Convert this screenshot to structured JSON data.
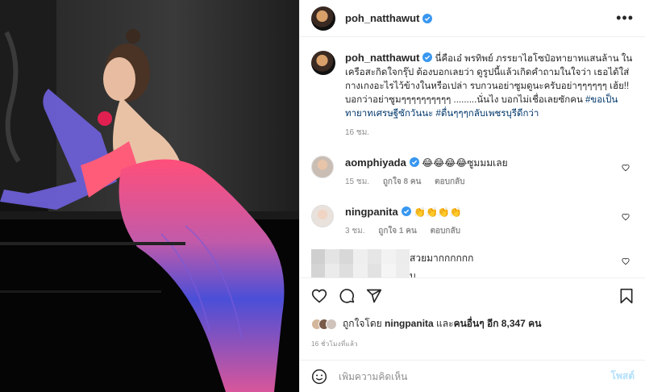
{
  "post": {
    "username": "poh_natthawut",
    "more_icon": "more-horizontal-icon",
    "caption_user": "poh_natthawut",
    "caption_text": " นี่คือเอ๋ พรทิพย์ ภรรยาไฮโซป๋อทายาทแสนล้าน ในเครือสะกิดใจกรุ๊ป ต้องบอกเลยว่า ดูรูปนี้แล้วเกิดคำถามในใจว่า เธอได้ใส่กางเกงอะไรไว้ข้างในหรือเปล่า รบกวนอย่าซูมดูนะครับอย่าๆๆๆๆๆๆ เฮ้ย!! บอกว่าอย่าซูมๆๆๆๆๆๆๆๆๆๆ .........นั่นไง บอกไม่เชื่อเลยซักคน ",
    "hashtag1": "#ขอเป็นทายาทเศรษฐีซักวันนะ",
    "hashtag2": "#ตื่นๆๆๆกลับเพชรบุรีดีกว่า",
    "caption_time": "16 ชม."
  },
  "comments": [
    {
      "user": "aomphiyada",
      "text": " 😂😂😂😂ซูมมมเลย",
      "time": "15 ชม.",
      "likes": "ถูกใจ 8 คน",
      "reply": "ตอบกลับ"
    },
    {
      "user": "ningpanita",
      "text": " 👏👏👏👏",
      "time": "3 ชม.",
      "likes": "ถูกใจ 1 คน",
      "reply": "ตอบกลับ"
    }
  ],
  "blurred_comment": {
    "text": "สวยมากกกกกก",
    "tail": "บ"
  },
  "likes": {
    "text": "ถูกใจโดย ",
    "by": "ningpanita",
    "and": " และ",
    "others": "คนอื่นๆ อีก 8,347 คน"
  },
  "time_ago": "16 ชั่วโมงที่แล้ว",
  "composer": {
    "placeholder": "เพิ่มความคิดเห็น",
    "post_label": "โพสต์"
  },
  "colors": {
    "verified": "#3897f0",
    "hashtag": "#00376b",
    "muted": "#8e8e8e"
  }
}
